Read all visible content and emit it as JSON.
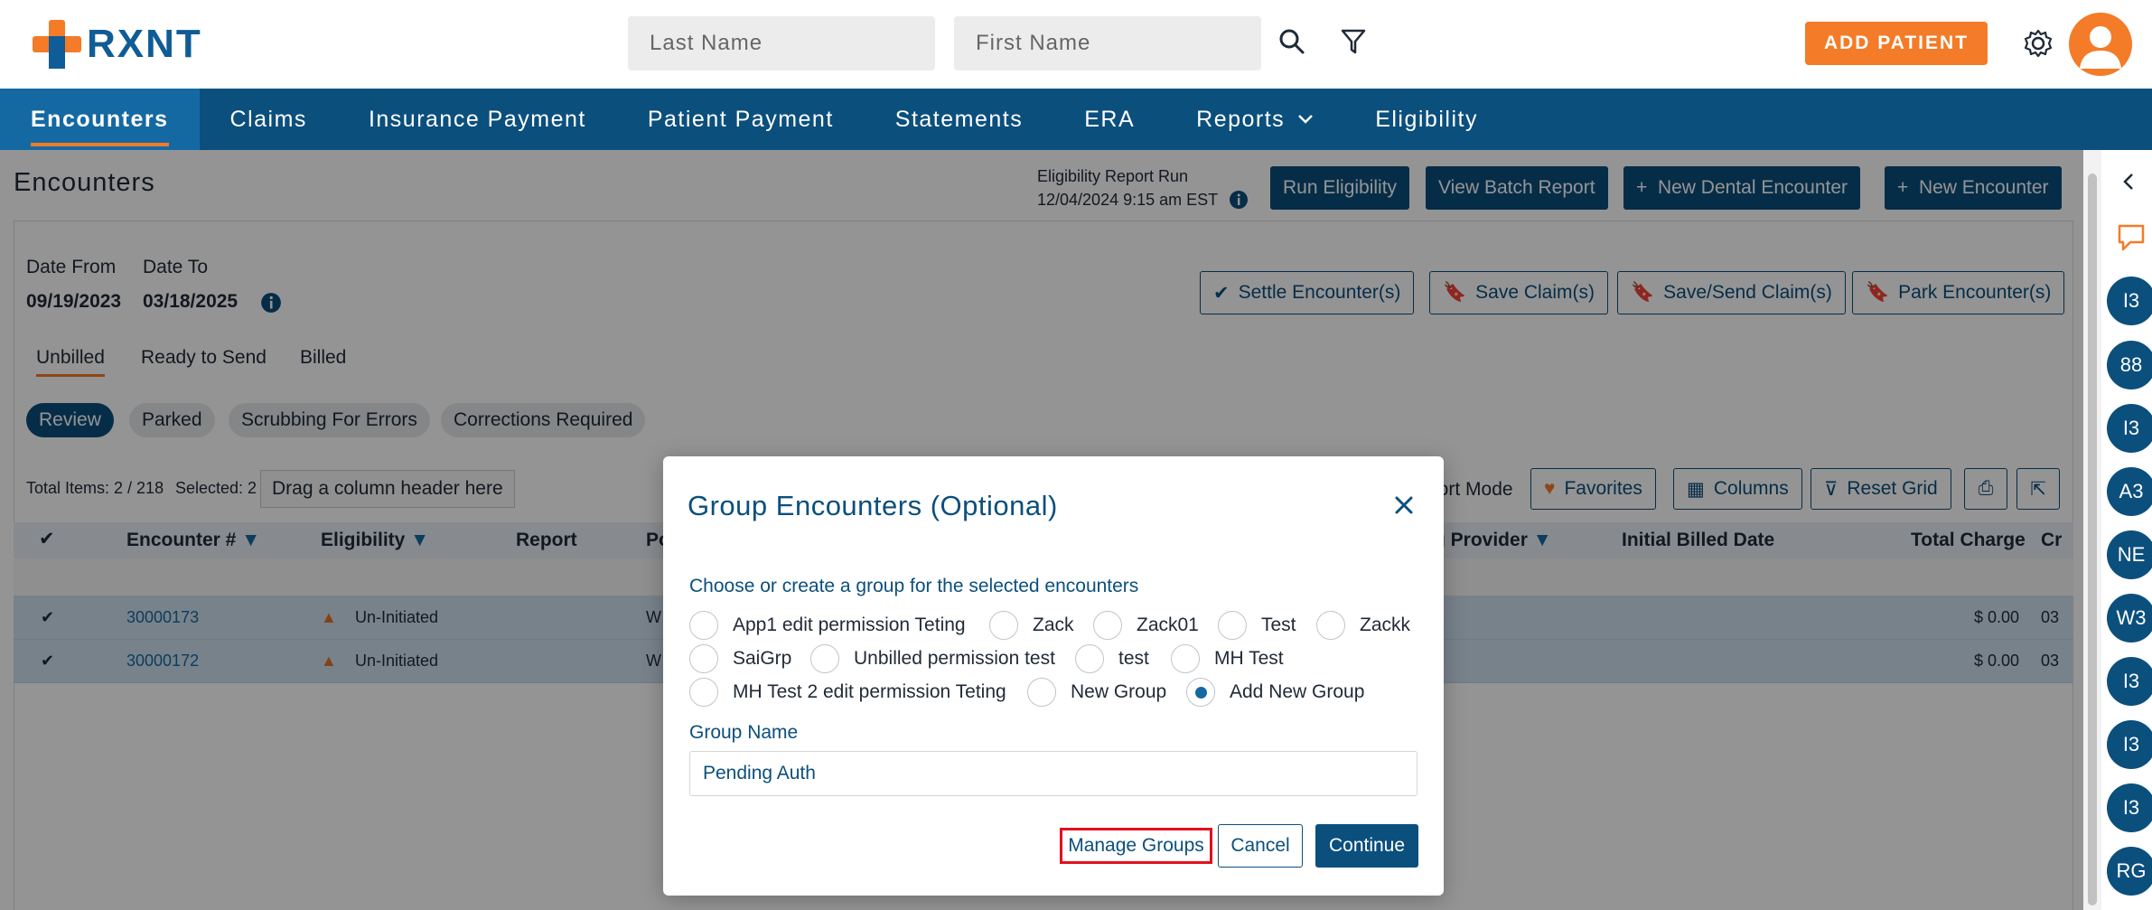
{
  "brand": {
    "name": "RXNT"
  },
  "header": {
    "last_name_placeholder": "Last Name",
    "first_name_placeholder": "First Name",
    "add_patient_label": "ADD PATIENT"
  },
  "nav": {
    "items": [
      {
        "label": "Encounters",
        "active": true
      },
      {
        "label": "Claims"
      },
      {
        "label": "Insurance Payment"
      },
      {
        "label": "Patient Payment"
      },
      {
        "label": "Statements"
      },
      {
        "label": "ERA"
      },
      {
        "label": "Reports"
      },
      {
        "label": "Eligibility"
      }
    ]
  },
  "page": {
    "title": "Encounters",
    "eligibility_run_label": "Eligibility Report Run",
    "eligibility_run_time": "12/04/2024 9:15 am EST",
    "actions": {
      "run_eligibility": "Run Eligibility",
      "view_batch_report": "View Batch Report",
      "new_dental_encounter": "New Dental Encounter",
      "new_encounter": "New Encounter"
    },
    "date_from_label": "Date From",
    "date_from": "09/19/2023",
    "date_to_label": "Date To",
    "date_to": "03/18/2025",
    "bulk_actions": {
      "settle": "Settle Encounter(s)",
      "save_claims": "Save Claim(s)",
      "save_send_claims": "Save/Send Claim(s)",
      "park": "Park Encounter(s)"
    },
    "subtabs": [
      "Unbilled",
      "Ready to Send",
      "Billed"
    ],
    "pills": [
      "Review",
      "Parked",
      "Scrubbing For Errors",
      "Corrections Required"
    ],
    "total_items": "Total Items: 2 / 218",
    "selected": "Selected: 2",
    "drag_hint": "Drag a column header here",
    "report_mode": "port Mode",
    "grid_tools": {
      "favorites": "Favorites",
      "columns": "Columns",
      "reset_grid": "Reset Grid"
    },
    "columns": {
      "encounter": "Encounter #",
      "eligibility": "Eligibility",
      "report": "Report",
      "po": "Po",
      "provider": "g Provider",
      "initial_billed_date": "Initial Billed Date",
      "total_charge": "Total Charge",
      "cr": "Cr"
    },
    "rows": [
      {
        "encounter": "30000173",
        "eligibility": "Un-Initiated",
        "po": "W",
        "total_charge": "$ 0.00",
        "cr": "03"
      },
      {
        "encounter": "30000172",
        "eligibility": "Un-Initiated",
        "po": "W",
        "total_charge": "$ 0.00",
        "cr": "03"
      }
    ]
  },
  "rail": {
    "avatars": [
      "I3",
      "88",
      "I3",
      "A3",
      "NE",
      "W3",
      "I3",
      "I3",
      "I3",
      "RG"
    ]
  },
  "modal": {
    "title": "Group Encounters (Optional)",
    "instruction": "Choose or create a group for the selected encounters",
    "groups": [
      {
        "label": "App1 edit permission Teting",
        "selected": false
      },
      {
        "label": "Zack",
        "selected": false
      },
      {
        "label": "Zack01",
        "selected": false
      },
      {
        "label": "Test",
        "selected": false
      },
      {
        "label": "Zackk",
        "selected": false
      },
      {
        "label": "SaiGrp",
        "selected": false
      },
      {
        "label": "Unbilled permission test",
        "selected": false
      },
      {
        "label": "test",
        "selected": false
      },
      {
        "label": "MH Test",
        "selected": false
      },
      {
        "label": "MH Test 2 edit permission Teting",
        "selected": false
      },
      {
        "label": "New Group",
        "selected": false
      },
      {
        "label": "Add New Group",
        "selected": true
      }
    ],
    "group_name_label": "Group Name",
    "group_name_value": "Pending Auth",
    "manage_groups": "Manage Groups",
    "cancel": "Cancel",
    "continue": "Continue"
  }
}
